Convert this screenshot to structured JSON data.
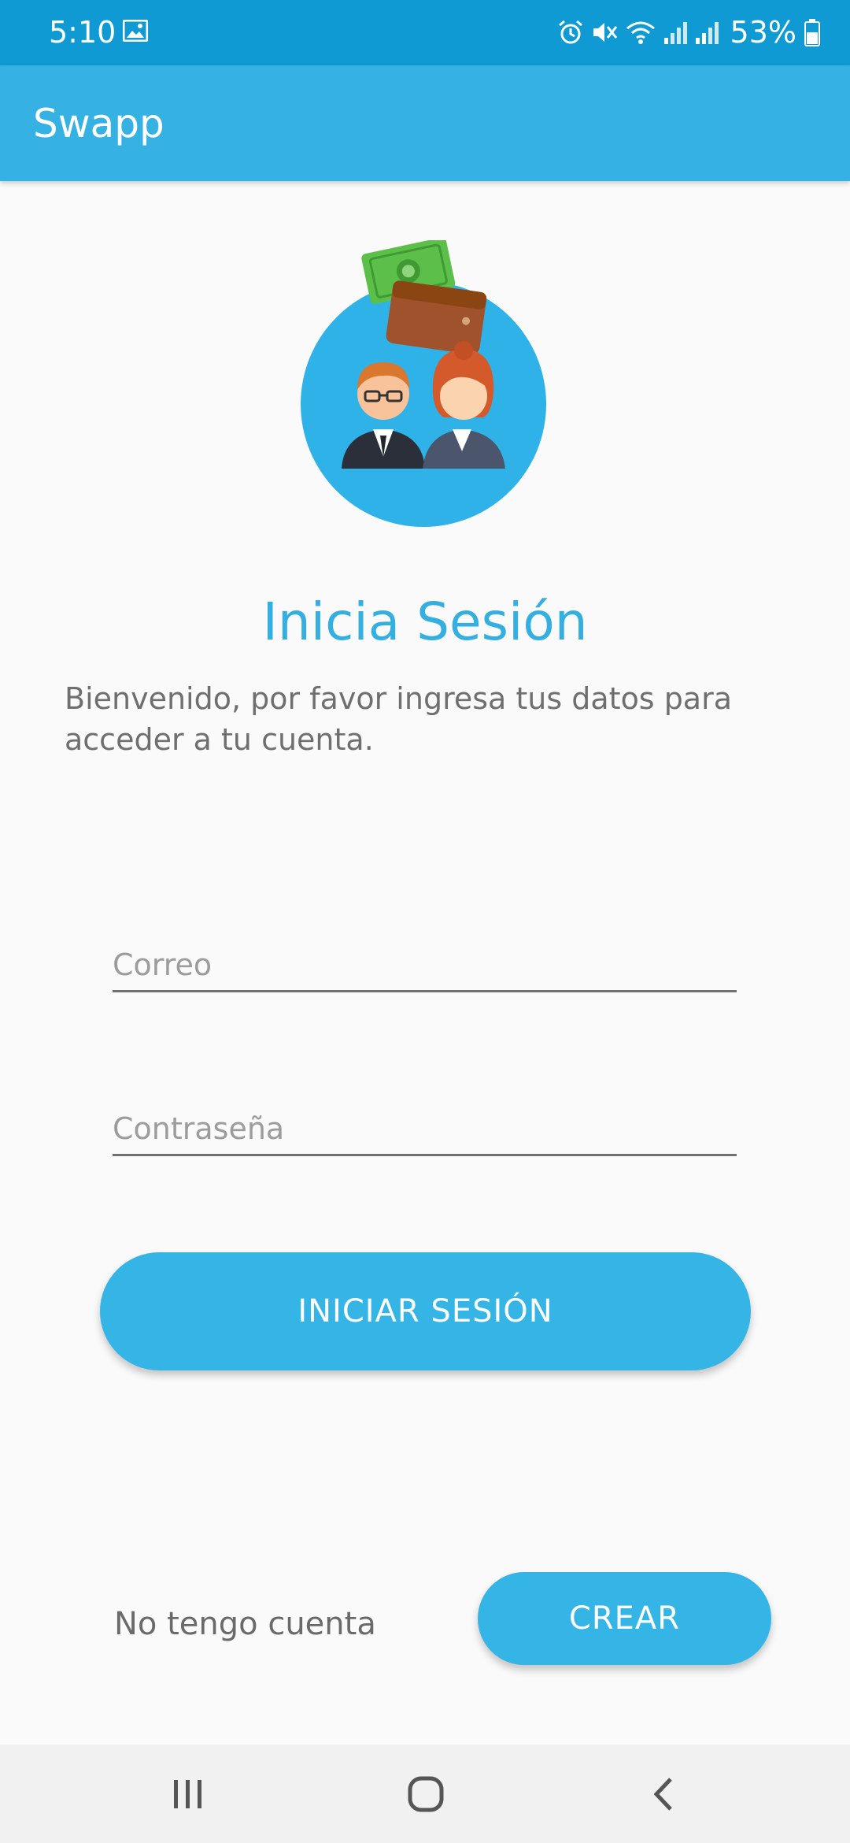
{
  "status_bar": {
    "time": "5:10",
    "battery": "53%",
    "icons": [
      "image-icon",
      "alarm-icon",
      "mute-icon",
      "wifi-icon",
      "signal-icon",
      "signal-icon",
      "battery-icon"
    ]
  },
  "app_bar": {
    "title": "Swapp"
  },
  "login": {
    "heading": "Inicia Sesión",
    "welcome": "Bienvenido, por favor ingresa tus datos para acceder a tu cuenta.",
    "email_placeholder": "Correo",
    "password_placeholder": "Contraseña",
    "login_button": "INICIAR SESIÓN",
    "no_account": "No tengo cuenta",
    "create_button": "CREAR"
  },
  "colors": {
    "status_bar": "#0f9ad3",
    "app_bar": "#35b1e4",
    "accent": "#35b5e6",
    "heading": "#35aee0",
    "background": "#fafafa"
  }
}
